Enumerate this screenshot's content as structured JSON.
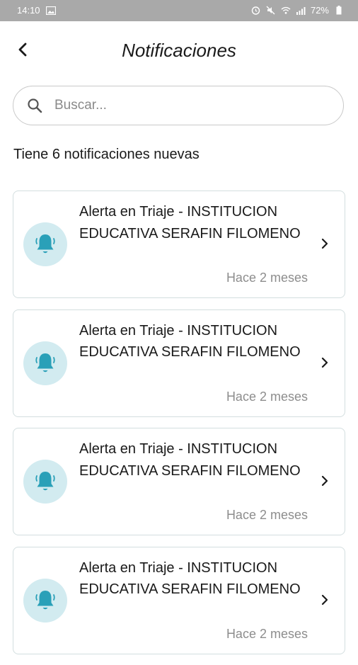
{
  "status_bar": {
    "time": "14:10",
    "battery": "72%"
  },
  "header": {
    "title": "Notificaciones"
  },
  "search": {
    "placeholder": "Buscar..."
  },
  "summary": {
    "text": "Tiene 6 notificaciones nuevas"
  },
  "notifications": [
    {
      "title": "Alerta en Triaje - INSTITUCION EDUCATIVA SERAFIN FILOMENO",
      "time": "Hace 2 meses"
    },
    {
      "title": "Alerta en Triaje - INSTITUCION EDUCATIVA SERAFIN FILOMENO",
      "time": "Hace 2 meses"
    },
    {
      "title": "Alerta en Triaje - INSTITUCION EDUCATIVA SERAFIN FILOMENO",
      "time": "Hace 2 meses"
    },
    {
      "title": "Alerta en Triaje - INSTITUCION EDUCATIVA SERAFIN FILOMENO",
      "time": "Hace 2 meses"
    }
  ],
  "icons": {
    "back": "back-arrow-icon",
    "search": "search-icon",
    "notification": "bell-icon",
    "chevron": "chevron-right-icon"
  },
  "colors": {
    "status_bar_bg": "#a9a9a9",
    "bell_circle": "#d2ebf0",
    "bell": "#2aa0b8",
    "card_border": "#d3dedf"
  }
}
